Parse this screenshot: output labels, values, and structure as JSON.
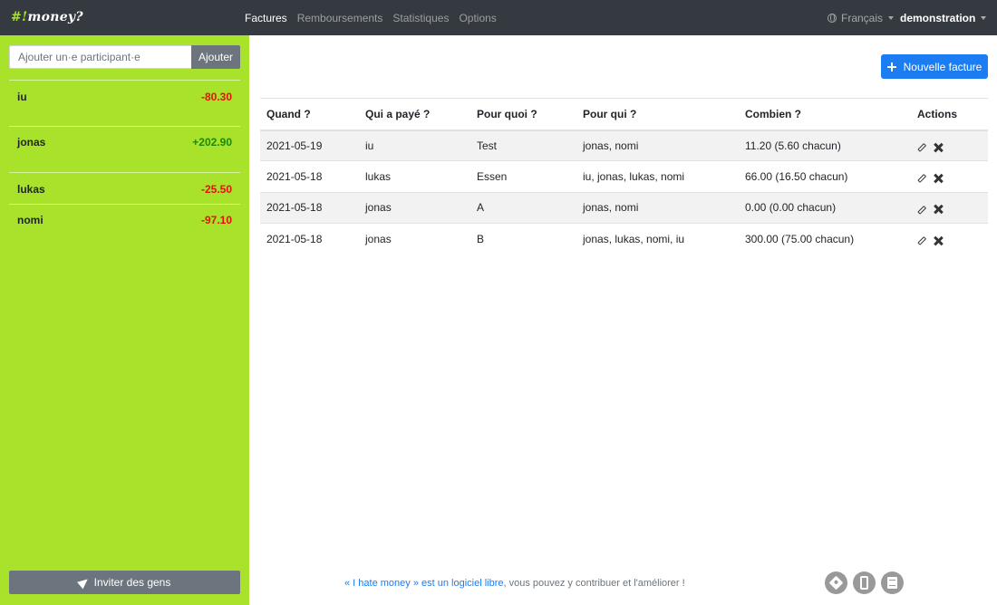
{
  "brand": {
    "prefix": "#!",
    "name": "money?"
  },
  "nav": {
    "links": [
      "Factures",
      "Remboursements",
      "Statistiques",
      "Options"
    ],
    "active": "Factures",
    "language": "Français",
    "user": "demonstration"
  },
  "sidebar": {
    "add_placeholder": "Ajouter un·e participant·e",
    "add_button": "Ajouter",
    "balances": [
      {
        "name": "iu",
        "amount": "-80.30",
        "status": "negative"
      },
      {
        "name": "jonas",
        "amount": "+202.90",
        "status": "positive"
      },
      {
        "name": "lukas",
        "amount": "-25.50",
        "status": "negative"
      },
      {
        "name": "nomi",
        "amount": "-97.10",
        "status": "negative"
      }
    ],
    "invite_button": "Inviter des gens"
  },
  "main": {
    "new_bill_button": "Nouvelle facture",
    "table": {
      "headers": [
        "Quand ?",
        "Qui a payé ?",
        "Pour quoi ?",
        "Pour qui ?",
        "Combien ?",
        "Actions"
      ],
      "rows": [
        [
          "2021-05-19",
          "iu",
          "Test",
          "jonas, nomi",
          "11.20 (5.60 chacun)"
        ],
        [
          "2021-05-18",
          "lukas",
          "Essen",
          "iu, jonas, lukas, nomi",
          "66.00 (16.50 chacun)"
        ],
        [
          "2021-05-18",
          "jonas",
          "A",
          "jonas, nomi",
          "0.00 (0.00 chacun)"
        ],
        [
          "2021-05-18",
          "jonas",
          "B",
          "jonas, lukas, nomi, iu",
          "300.00 (75.00 chacun)"
        ]
      ]
    }
  },
  "footer": {
    "link_text": "« I hate money » est un logiciel libre",
    "text": ", vous pouvez y contribuer et l'améliorer !",
    "icons": [
      "git-icon",
      "mobile-icon",
      "book-icon"
    ]
  },
  "colors": {
    "navbar": "#343a40",
    "sidebar": "#a8e22a",
    "primary": "#1c7cf2",
    "negative": "#e8100e",
    "positive": "#1a8a0c"
  }
}
